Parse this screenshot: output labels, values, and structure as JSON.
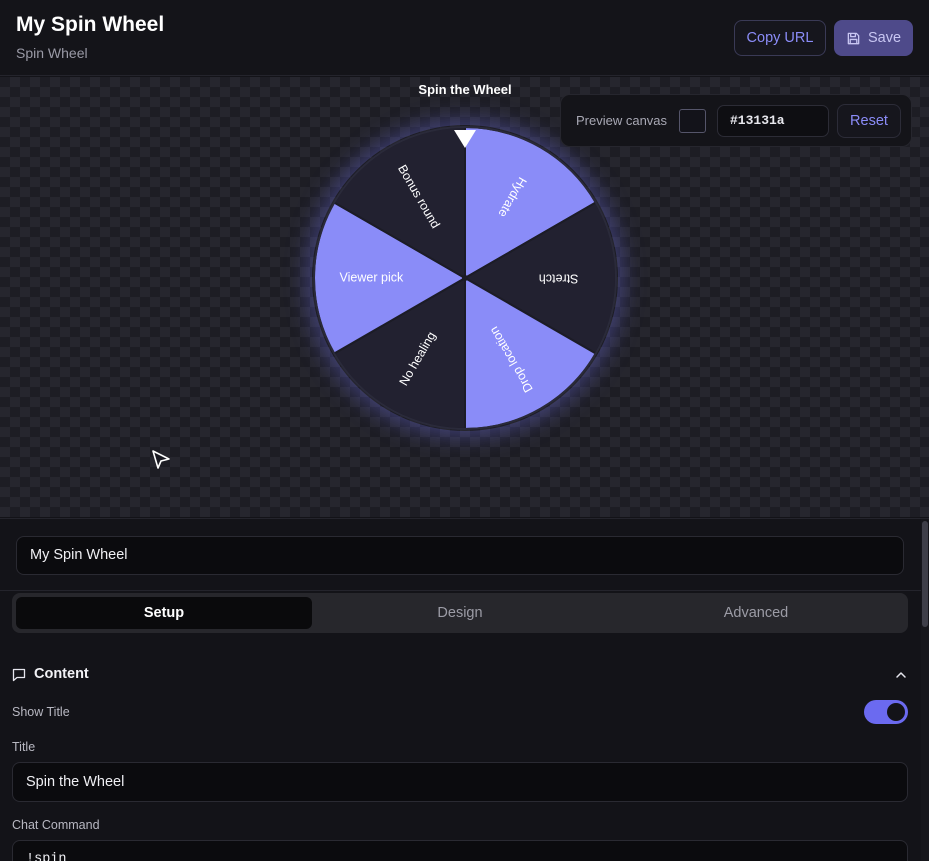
{
  "header": {
    "title": "My Spin Wheel",
    "subtitle": "Spin Wheel",
    "copy_url_label": "Copy URL",
    "save_label": "Save",
    "save_icon": "save-icon"
  },
  "preview": {
    "wheel_title": "Spin the Wheel",
    "segments": [
      {
        "label": "Hydrate",
        "color": "#8a8cf8"
      },
      {
        "label": "Stretch",
        "color": "#222130"
      },
      {
        "label": "Drop location",
        "color": "#8a8cf8"
      },
      {
        "label": "No healing",
        "color": "#222130"
      },
      {
        "label": "Viewer pick",
        "color": "#8a8cf8"
      },
      {
        "label": "Bonus round",
        "color": "#222130"
      }
    ],
    "canvas_label": "Preview canvas",
    "canvas_color": "#13131a",
    "reset_label": "Reset"
  },
  "editor": {
    "name_value": "My Spin Wheel",
    "tabs": [
      {
        "label": "Setup",
        "active": true
      },
      {
        "label": "Design",
        "active": false
      },
      {
        "label": "Advanced",
        "active": false
      }
    ],
    "section_title": "Content",
    "show_title_label": "Show Title",
    "show_title_on": true,
    "title_label": "Title",
    "title_value": "Spin the Wheel",
    "chat_command_label": "Chat Command",
    "chat_command_value": "!spin"
  },
  "colors": {
    "accent": "#6b6af0",
    "segment_light": "#8a8cf8",
    "segment_dark": "#222130"
  }
}
